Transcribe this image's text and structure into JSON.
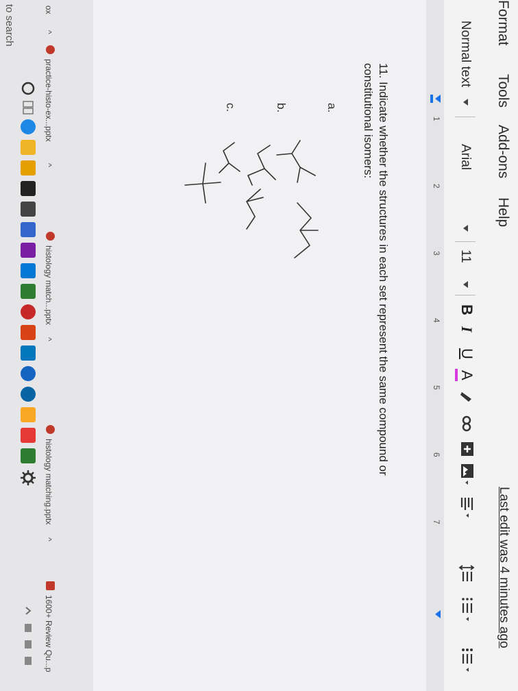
{
  "menu": {
    "items": [
      "Format",
      "Tools",
      "Add-ons",
      "Help"
    ],
    "last_edit": "Last edit was 4 minutes ago"
  },
  "toolbar": {
    "style": "Normal text",
    "font": "Arial",
    "size": "11",
    "bold": "B",
    "italic": "I",
    "underline": "U",
    "text_color": "A",
    "colors": {
      "text_color_bar": "#d63adf",
      "accent": "#1a73e8"
    }
  },
  "ruler": {
    "marks": [
      "1",
      "2",
      "3",
      "4",
      "5",
      "6",
      "7"
    ]
  },
  "document": {
    "question": "11. Indicate whether the structures in each set represent the same compound or constitutional isomers:",
    "parts": [
      "a.",
      "b.",
      "c."
    ]
  },
  "taskbar": {
    "tabs": [
      {
        "label": "practice-histo-ex...pptx",
        "chevron": "^"
      },
      {
        "label": "histology match...pptx",
        "chevron": "^"
      },
      {
        "label": "histology matching.pptx",
        "chevron": "^"
      },
      {
        "label": "1600+ Review Qu...p",
        "chevron": ""
      }
    ],
    "search": "to search",
    "left_label": "ox",
    "left_chevron": "^"
  }
}
